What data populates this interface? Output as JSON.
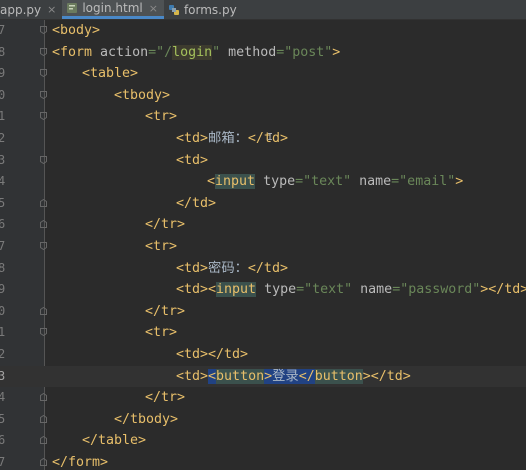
{
  "tabs": [
    {
      "label": "app.py",
      "icon": "python-file-icon",
      "active": false
    },
    {
      "label": "login.html",
      "icon": "html-file-icon",
      "active": true
    },
    {
      "label": "forms.py",
      "icon": "python-file-icon",
      "active": false
    }
  ],
  "tab_close_glyph": "×",
  "line_numbers": [
    "7",
    "8",
    "9",
    "0",
    "1",
    "2",
    "3",
    "4",
    "5",
    "6",
    "7",
    "8",
    "9",
    "0",
    "1",
    "2",
    "3",
    "4",
    "5",
    "6",
    "7",
    "8"
  ],
  "code": {
    "l0_open": "<body>",
    "l1_a": "<form ",
    "l1_b": "action",
    "l1_c": "=\"/",
    "l1_d": "login",
    "l1_e": "\" ",
    "l1_f": "method",
    "l1_g": "=\"post\"",
    "l1_h": ">",
    "l2": "<table>",
    "l3": "<tbody>",
    "l4": "<tr>",
    "l5_a": "<td>",
    "l5_b": "邮箱：",
    "l5_c": "</td>",
    "l6": "<td>",
    "l7_a": "<",
    "l7_b": "input",
    "l7_c": " ",
    "l7_d": "type",
    "l7_e": "=\"text\" ",
    "l7_f": "name",
    "l7_g": "=\"email\"",
    "l7_h": ">",
    "l8": "</td>",
    "l9": "</tr>",
    "l10": "<tr>",
    "l11_a": "<td>",
    "l11_b": "密码：",
    "l11_c": "</td>",
    "l12_a": "<td><",
    "l12_b": "input",
    "l12_c": " ",
    "l12_d": "type",
    "l12_e": "=\"text\" ",
    "l12_f": "name",
    "l12_g": "=\"password\"",
    "l12_h": "></td>",
    "l13": "</tr>",
    "l14": "<tr>",
    "l15": "<td></td>",
    "l16_a": "<td>",
    "l16_b": "<",
    "l16_c": "button",
    "l16_d": ">",
    "l16_e": "登录",
    "l16_f": "</",
    "l16_g": "button",
    "l16_h": ">",
    "l16_i": "</td>",
    "l17": "</tr>",
    "l18": "</tbody>",
    "l19": "</table>",
    "l20": "</form>"
  },
  "text_cursor": "I",
  "colors": {
    "background": "#2b2b2b",
    "tag": "#e8bf6a",
    "attribute": "#bababa",
    "string": "#6a8759",
    "selection": "#214283"
  }
}
